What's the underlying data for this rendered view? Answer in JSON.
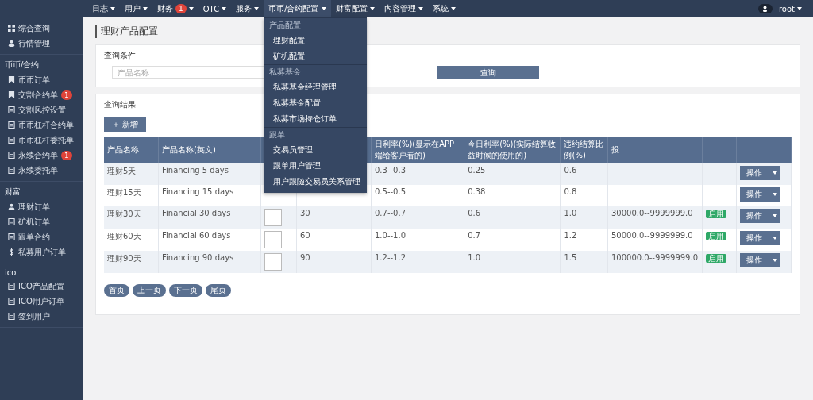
{
  "topnav": {
    "items": [
      {
        "label": "日志",
        "selected": false
      },
      {
        "label": "用户",
        "selected": false
      },
      {
        "label": "财务",
        "badge": "1",
        "selected": false
      },
      {
        "label": "OTC",
        "selected": false
      },
      {
        "label": "服务",
        "selected": false
      },
      {
        "label": "币币/合约配置",
        "selected": true
      },
      {
        "label": "财富配置",
        "selected": false
      },
      {
        "label": "内容管理",
        "selected": false
      },
      {
        "label": "系统",
        "selected": false
      }
    ],
    "user": "root"
  },
  "dropdown": [
    {
      "group": "产品配置",
      "items": [
        "理财配置",
        "矿机配置"
      ]
    },
    {
      "group": "私募基金",
      "items": [
        "私募基金经理管理",
        "私募基金配置",
        "私募市场持仓订单"
      ]
    },
    {
      "group": "跟单",
      "items": [
        "交易员管理",
        "跟单用户管理",
        "用户跟随交易员关系管理"
      ]
    }
  ],
  "sidebar": [
    {
      "items": [
        {
          "label": "综合查询"
        },
        {
          "label": "行情管理"
        }
      ]
    },
    {
      "group": "币币/合约",
      "items": [
        {
          "label": "币币订单"
        },
        {
          "label": "交割合约单",
          "badge": "1"
        },
        {
          "label": "交割风控设置"
        },
        {
          "label": "币币杠杆合约单"
        },
        {
          "label": "币币杠杆委托单"
        },
        {
          "label": "永续合约单",
          "badge": "1"
        },
        {
          "label": "永续委托单"
        }
      ]
    },
    {
      "group": "财富",
      "items": [
        {
          "label": "理财订单"
        },
        {
          "label": "矿机订单"
        },
        {
          "label": "跟单合约"
        },
        {
          "label": "私募用户订单"
        }
      ]
    },
    {
      "group": "ico",
      "items": [
        {
          "label": "ICO产品配置"
        },
        {
          "label": "ICO用户订单"
        },
        {
          "label": "签到用户"
        }
      ]
    }
  ],
  "page_title": "理财产品配置",
  "query": {
    "title": "查询条件",
    "placeholder": "产品名称",
    "button": "查询"
  },
  "results": {
    "title": "查询结果",
    "add_button": "＋ 新增",
    "columns": [
      "产品名称",
      "产品名称(英文)",
      "日利率(%)(显示在APP端给客户看的)",
      "今日利率(%)(实际结算收益时候的使用的)",
      "违约结算比例(%)",
      "投"
    ],
    "rows": [
      {
        "name": "理财5天",
        "name_en": "Financing 5 days",
        "rate": "0.3--0.3",
        "today": "0.25",
        "penalty": "0.6",
        "action": "操作"
      },
      {
        "name": "理财15天",
        "name_en": "Financing 15 days",
        "rate": "0.5--0.5",
        "today": "0.38",
        "penalty": "0.8",
        "action": "操作"
      },
      {
        "name": "理财30天",
        "name_en": "Financial 30 days",
        "image": true,
        "days": "30",
        "rate": "0.7--0.7",
        "today": "0.6",
        "penalty": "1.0",
        "amount": "30000.0--9999999.0",
        "status": "启用",
        "action": "操作"
      },
      {
        "name": "理财60天",
        "name_en": "Financial 60 days",
        "image": true,
        "days": "60",
        "rate": "1.0--1.0",
        "today": "0.7",
        "penalty": "1.2",
        "amount": "50000.0--9999999.0",
        "status": "启用",
        "action": "操作"
      },
      {
        "name": "理财90天",
        "name_en": "Financing 90 days",
        "image": true,
        "days": "90",
        "rate": "1.2--1.2",
        "today": "1.0",
        "penalty": "1.5",
        "amount": "100000.0--9999999.0",
        "status": "启用",
        "action": "操作"
      }
    ]
  },
  "pagination": [
    "首页",
    "上一页",
    "下一页",
    "尾页"
  ]
}
